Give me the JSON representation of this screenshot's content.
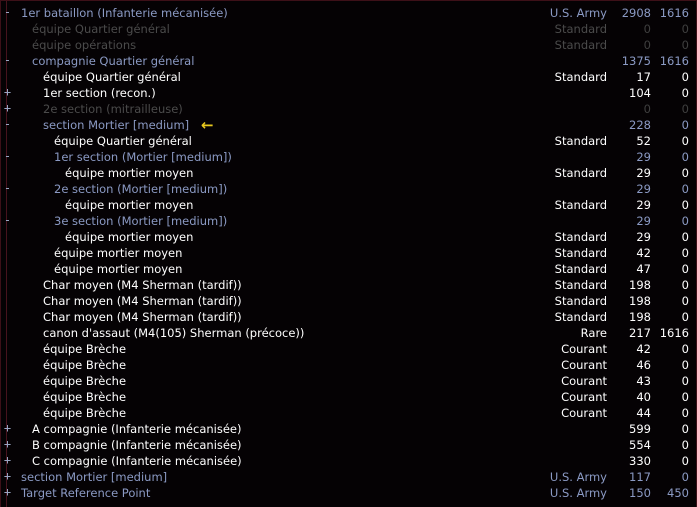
{
  "window": {
    "title": "Order of Battle tree",
    "background_color": "#050204",
    "border_color": "#3d1018",
    "group_text_color": "#8b9ac4",
    "item_text_color": "#ffffff",
    "disabled_text_color": "#4b4b4b",
    "marker_color": "#e8c81e"
  },
  "columns": {
    "name_header": "",
    "availability_header": "",
    "value1_header": "",
    "value2_header": ""
  },
  "icons": {
    "expand": "+",
    "collapse": "-",
    "selection_marker": "←"
  },
  "rows": [
    {
      "toggle": "-",
      "indent": 0,
      "label": "1er bataillon (Infanterie mécanisée)",
      "avail": "U.S. Army",
      "v1": "2908",
      "v2": "1616",
      "style": "group",
      "marker": false
    },
    {
      "toggle": "",
      "indent": 1,
      "label": "équipe Quartier général",
      "avail": "Standard",
      "v1": "0",
      "v2": "0",
      "style": "dim",
      "marker": false
    },
    {
      "toggle": "",
      "indent": 1,
      "label": "équipe opérations",
      "avail": "Standard",
      "v1": "0",
      "v2": "0",
      "style": "dim",
      "marker": false
    },
    {
      "toggle": "-",
      "indent": 1,
      "label": "compagnie Quartier général",
      "avail": "",
      "v1": "1375",
      "v2": "1616",
      "style": "group",
      "marker": false
    },
    {
      "toggle": "",
      "indent": 2,
      "label": "équipe Quartier général",
      "avail": "Standard",
      "v1": "17",
      "v2": "0",
      "style": "item",
      "marker": false
    },
    {
      "toggle": "+",
      "indent": 2,
      "label": "1er section (recon.)",
      "avail": "",
      "v1": "104",
      "v2": "0",
      "style": "item",
      "marker": false
    },
    {
      "toggle": "+",
      "indent": 2,
      "label": "2e section (mitrailleuse)",
      "avail": "",
      "v1": "0",
      "v2": "0",
      "style": "dim",
      "marker": false
    },
    {
      "toggle": "-",
      "indent": 2,
      "label": "section Mortier [medium]",
      "avail": "",
      "v1": "228",
      "v2": "0",
      "style": "group",
      "marker": true
    },
    {
      "toggle": "",
      "indent": 3,
      "label": "équipe Quartier général",
      "avail": "Standard",
      "v1": "52",
      "v2": "0",
      "style": "item",
      "marker": false
    },
    {
      "toggle": "-",
      "indent": 3,
      "label": "1er section (Mortier [medium])",
      "avail": "",
      "v1": "29",
      "v2": "0",
      "style": "group",
      "marker": false
    },
    {
      "toggle": "",
      "indent": 4,
      "label": "équipe mortier moyen",
      "avail": "Standard",
      "v1": "29",
      "v2": "0",
      "style": "item",
      "marker": false
    },
    {
      "toggle": "-",
      "indent": 3,
      "label": "2e section (Mortier [medium])",
      "avail": "",
      "v1": "29",
      "v2": "0",
      "style": "group",
      "marker": false
    },
    {
      "toggle": "",
      "indent": 4,
      "label": "équipe mortier moyen",
      "avail": "Standard",
      "v1": "29",
      "v2": "0",
      "style": "item",
      "marker": false
    },
    {
      "toggle": "-",
      "indent": 3,
      "label": "3e section (Mortier [medium])",
      "avail": "",
      "v1": "29",
      "v2": "0",
      "style": "group",
      "marker": false
    },
    {
      "toggle": "",
      "indent": 4,
      "label": "équipe mortier moyen",
      "avail": "Standard",
      "v1": "29",
      "v2": "0",
      "style": "item",
      "marker": false
    },
    {
      "toggle": "",
      "indent": 3,
      "label": "équipe mortier moyen",
      "avail": "Standard",
      "v1": "42",
      "v2": "0",
      "style": "item",
      "marker": false
    },
    {
      "toggle": "",
      "indent": 3,
      "label": "équipe mortier moyen",
      "avail": "Standard",
      "v1": "47",
      "v2": "0",
      "style": "item",
      "marker": false
    },
    {
      "toggle": "",
      "indent": 2,
      "label": "Char moyen (M4 Sherman (tardif))",
      "avail": "Standard",
      "v1": "198",
      "v2": "0",
      "style": "item",
      "marker": false
    },
    {
      "toggle": "",
      "indent": 2,
      "label": "Char moyen (M4 Sherman (tardif))",
      "avail": "Standard",
      "v1": "198",
      "v2": "0",
      "style": "item",
      "marker": false
    },
    {
      "toggle": "",
      "indent": 2,
      "label": "Char moyen (M4 Sherman (tardif))",
      "avail": "Standard",
      "v1": "198",
      "v2": "0",
      "style": "item",
      "marker": false
    },
    {
      "toggle": "",
      "indent": 2,
      "label": "canon d'assaut (M4(105) Sherman (précoce))",
      "avail": "Rare",
      "v1": "217",
      "v2": "1616",
      "style": "item",
      "marker": false
    },
    {
      "toggle": "",
      "indent": 2,
      "label": "équipe Brèche",
      "avail": "Courant",
      "v1": "42",
      "v2": "0",
      "style": "item",
      "marker": false
    },
    {
      "toggle": "",
      "indent": 2,
      "label": "équipe Brèche",
      "avail": "Courant",
      "v1": "46",
      "v2": "0",
      "style": "item",
      "marker": false
    },
    {
      "toggle": "",
      "indent": 2,
      "label": "équipe Brèche",
      "avail": "Courant",
      "v1": "43",
      "v2": "0",
      "style": "item",
      "marker": false
    },
    {
      "toggle": "",
      "indent": 2,
      "label": "équipe Brèche",
      "avail": "Courant",
      "v1": "40",
      "v2": "0",
      "style": "item",
      "marker": false
    },
    {
      "toggle": "",
      "indent": 2,
      "label": "équipe Brèche",
      "avail": "Courant",
      "v1": "44",
      "v2": "0",
      "style": "item",
      "marker": false
    },
    {
      "toggle": "+",
      "indent": 1,
      "label": "A compagnie (Infanterie mécanisée)",
      "avail": "",
      "v1": "599",
      "v2": "0",
      "style": "item",
      "marker": false
    },
    {
      "toggle": "+",
      "indent": 1,
      "label": "B compagnie (Infanterie mécanisée)",
      "avail": "",
      "v1": "554",
      "v2": "0",
      "style": "item",
      "marker": false
    },
    {
      "toggle": "+",
      "indent": 1,
      "label": "C compagnie (Infanterie mécanisée)",
      "avail": "",
      "v1": "330",
      "v2": "0",
      "style": "item",
      "marker": false
    },
    {
      "toggle": "+",
      "indent": 0,
      "label": "section Mortier [medium]",
      "avail": "U.S. Army",
      "v1": "117",
      "v2": "0",
      "style": "group",
      "marker": false
    },
    {
      "toggle": "+",
      "indent": 0,
      "label": "Target Reference Point",
      "avail": "U.S. Army",
      "v1": "150",
      "v2": "450",
      "style": "group",
      "marker": false
    }
  ]
}
